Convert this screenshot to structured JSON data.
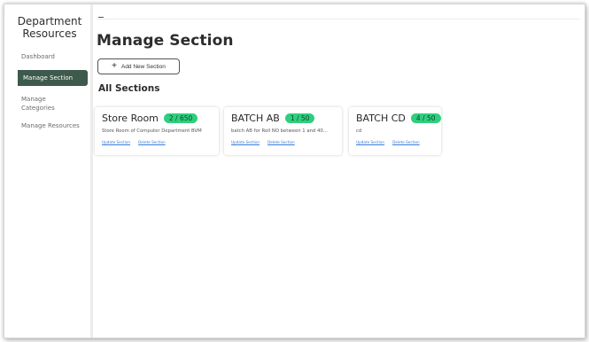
{
  "sidebar": {
    "brand_line1": "Department",
    "brand_line2": "Resources",
    "items": [
      {
        "label": "Dashboard"
      },
      {
        "label": "Manage Section"
      },
      {
        "label": "Manage Categories"
      },
      {
        "label": "Manage Resources"
      }
    ],
    "active_index": 1
  },
  "main": {
    "title": "Manage Section",
    "add_button_label": "Add New Section",
    "sections_heading": "All Sections"
  },
  "sections": [
    {
      "name": "Store Room",
      "count": "2 / 650",
      "description": "Store Room of Computer Department BVM",
      "update_label": "Update Section",
      "delete_label": "Delete Section"
    },
    {
      "name": "BATCH AB",
      "count": "1 / 50",
      "description": "batch AB for Roll NO between 1 and 40...",
      "update_label": "Update Section",
      "delete_label": "Delete Section"
    },
    {
      "name": "BATCH CD",
      "count": "4 / 50",
      "description": "cd",
      "update_label": "Update Section",
      "delete_label": "Delete Section"
    }
  ],
  "colors": {
    "sidebar_active": "#3d5a4c",
    "badge": "#2ecf7d",
    "link": "#3b7bd6"
  }
}
